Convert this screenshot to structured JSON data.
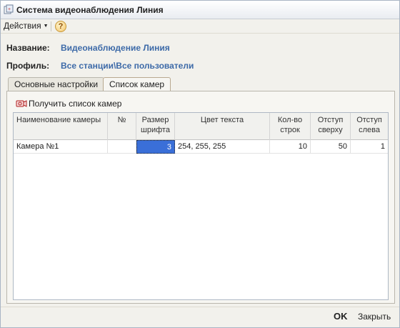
{
  "window": {
    "title": "Система видеонаблюдения Линия"
  },
  "toolbar": {
    "actions_label": "Действия",
    "help_label": "?"
  },
  "fields": {
    "name_label": "Название:",
    "name_value": "Видеонаблюдение Линия",
    "profile_label": "Профиль:",
    "profile_value": "Все станции\\Все пользователи"
  },
  "tabs": [
    {
      "label": "Основные настройки",
      "active": false
    },
    {
      "label": "Список камер",
      "active": true
    }
  ],
  "camera_panel": {
    "get_cameras_label": "Получить список камер",
    "columns": [
      {
        "line1": "Наименование камеры",
        "line2": ""
      },
      {
        "line1": "№",
        "line2": ""
      },
      {
        "line1": "Размер",
        "line2": "шрифта"
      },
      {
        "line1": "Цвет текста",
        "line2": ""
      },
      {
        "line1": "Кол-во",
        "line2": "строк"
      },
      {
        "line1": "Отступ",
        "line2": "сверху"
      },
      {
        "line1": "Отступ",
        "line2": "слева"
      }
    ],
    "rows": [
      {
        "name": "Камера №1",
        "num": "",
        "font_size": "3",
        "text_color": "254, 255, 255",
        "lines": "10",
        "offset_top": "50",
        "offset_left": "1"
      }
    ]
  },
  "footer": {
    "ok_label": "OK",
    "close_label": "Закрыть"
  },
  "colors": {
    "accent_value_text": "#3d6aa8",
    "selected_cell": "#3a6fd8"
  }
}
